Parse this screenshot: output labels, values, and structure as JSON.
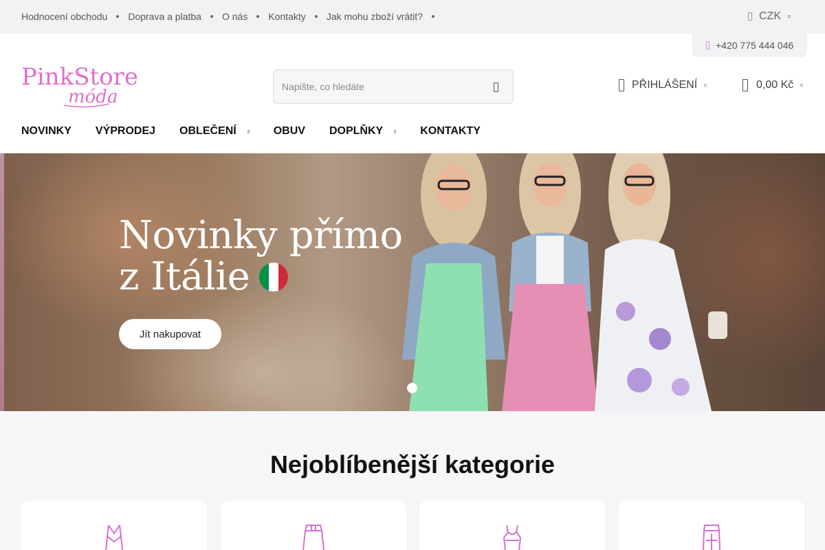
{
  "topbar": {
    "links": [
      "Hodnocení obchodu",
      "Doprava a platba",
      "O nás",
      "Kontakty",
      "Jak mohu zboží vrátit?"
    ],
    "currency": "CZK"
  },
  "header": {
    "phone": "+420 775 444 046",
    "logo_main": "PinkStore",
    "logo_sub": "móda",
    "search_placeholder": "Napište, co hledáte",
    "login_label": "PŘIHLÁŠENÍ",
    "cart_total": "0,00 Kč"
  },
  "nav": {
    "items": [
      "NOVINKY",
      "VÝPRODEJ",
      "OBLEČENÍ",
      "OBUV",
      "DOPLŇKY",
      "KONTAKTY"
    ]
  },
  "hero": {
    "title_line1": "Novinky přímo",
    "title_line2": "z Itálie",
    "button_label": "Jít nakupovat",
    "flag_colors": [
      "#009246",
      "#ffffff",
      "#ce2b37"
    ]
  },
  "categories": {
    "title": "Nejoblíbenější kategorie",
    "icons": [
      "dress-icon",
      "skirt-icon",
      "top-icon",
      "pants-icon"
    ]
  },
  "colors": {
    "brand_pink": "#e070c8"
  }
}
